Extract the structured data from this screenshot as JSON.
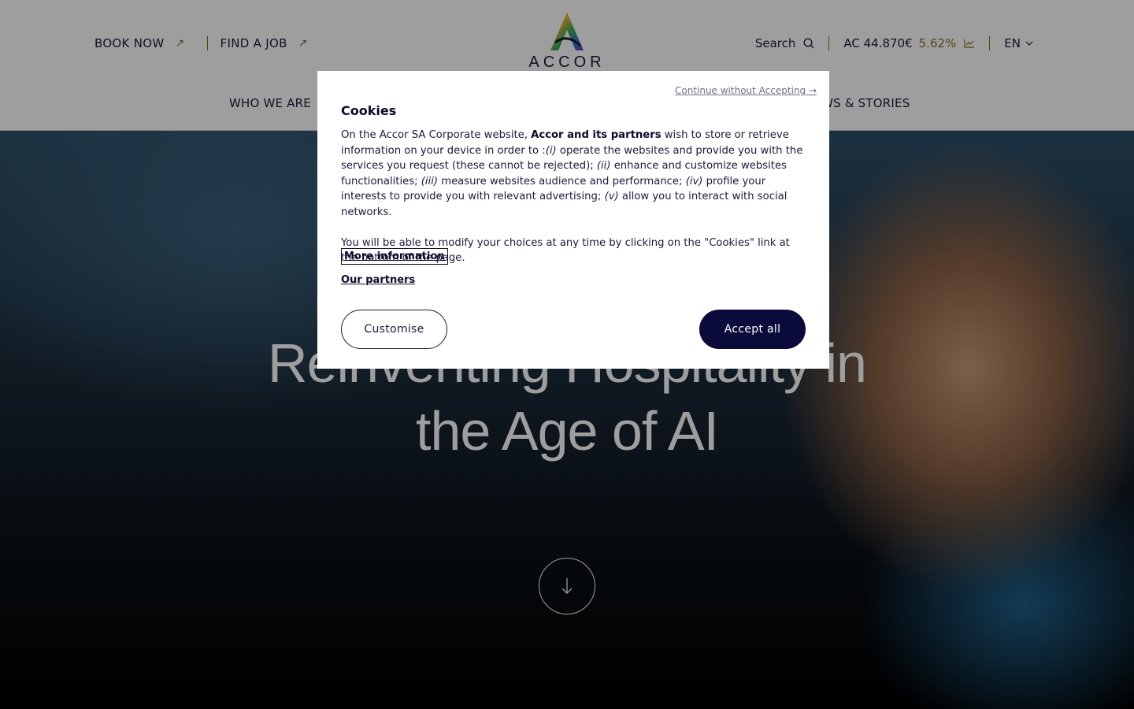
{
  "header": {
    "top_left": {
      "book_now": "BOOK NOW",
      "find_job": "FIND A JOB"
    },
    "logo_text": "ACCOR",
    "top_right": {
      "search": "Search",
      "stock_label": "AC 44.870€",
      "stock_change": "5.62%",
      "language": "EN"
    },
    "nav": {
      "who_we_are": "WHO WE ARE",
      "news_stories": "NEWS & STORIES"
    }
  },
  "hero": {
    "title_line1": "Reinventing Hospitality in",
    "title_line2": "the Age of AI"
  },
  "cookie_modal": {
    "continue_link": "Continue without Accepting →",
    "title": "Cookies",
    "intro_prefix": "On the Accor SA Corporate website, ",
    "intro_bold": "Accor and its partners",
    "intro_suffix": " wish to store or retrieve information on your device in order to :",
    "item_i_marker": "(i)",
    "item_i_text": " operate the websites and provide you with the services you request (these cannot be rejected); ",
    "item_ii_marker": "(ii)",
    "item_ii_text": " enhance and customize websites functionalities; ",
    "item_iii_marker": "(iii)",
    "item_iii_text": " measure websites audience and performance; ",
    "item_iv_marker": "(iv)",
    "item_iv_text": " profile your interests to provide you with relevant advertising; ",
    "item_v_marker": "(v)",
    "item_v_text": " allow you to interact with social networks.",
    "paragraph2": "You will be able to modify your choices at any time by clicking on the \"Cookies\" link at the bottom of the page.",
    "more_information": "More information",
    "our_partners": "Our partners",
    "customise": "Customise",
    "accept_all": "Accept all"
  },
  "colors": {
    "navy": "#0b0b3b",
    "gold": "#8a6d2f",
    "text_dark": "#1b1a3a"
  }
}
